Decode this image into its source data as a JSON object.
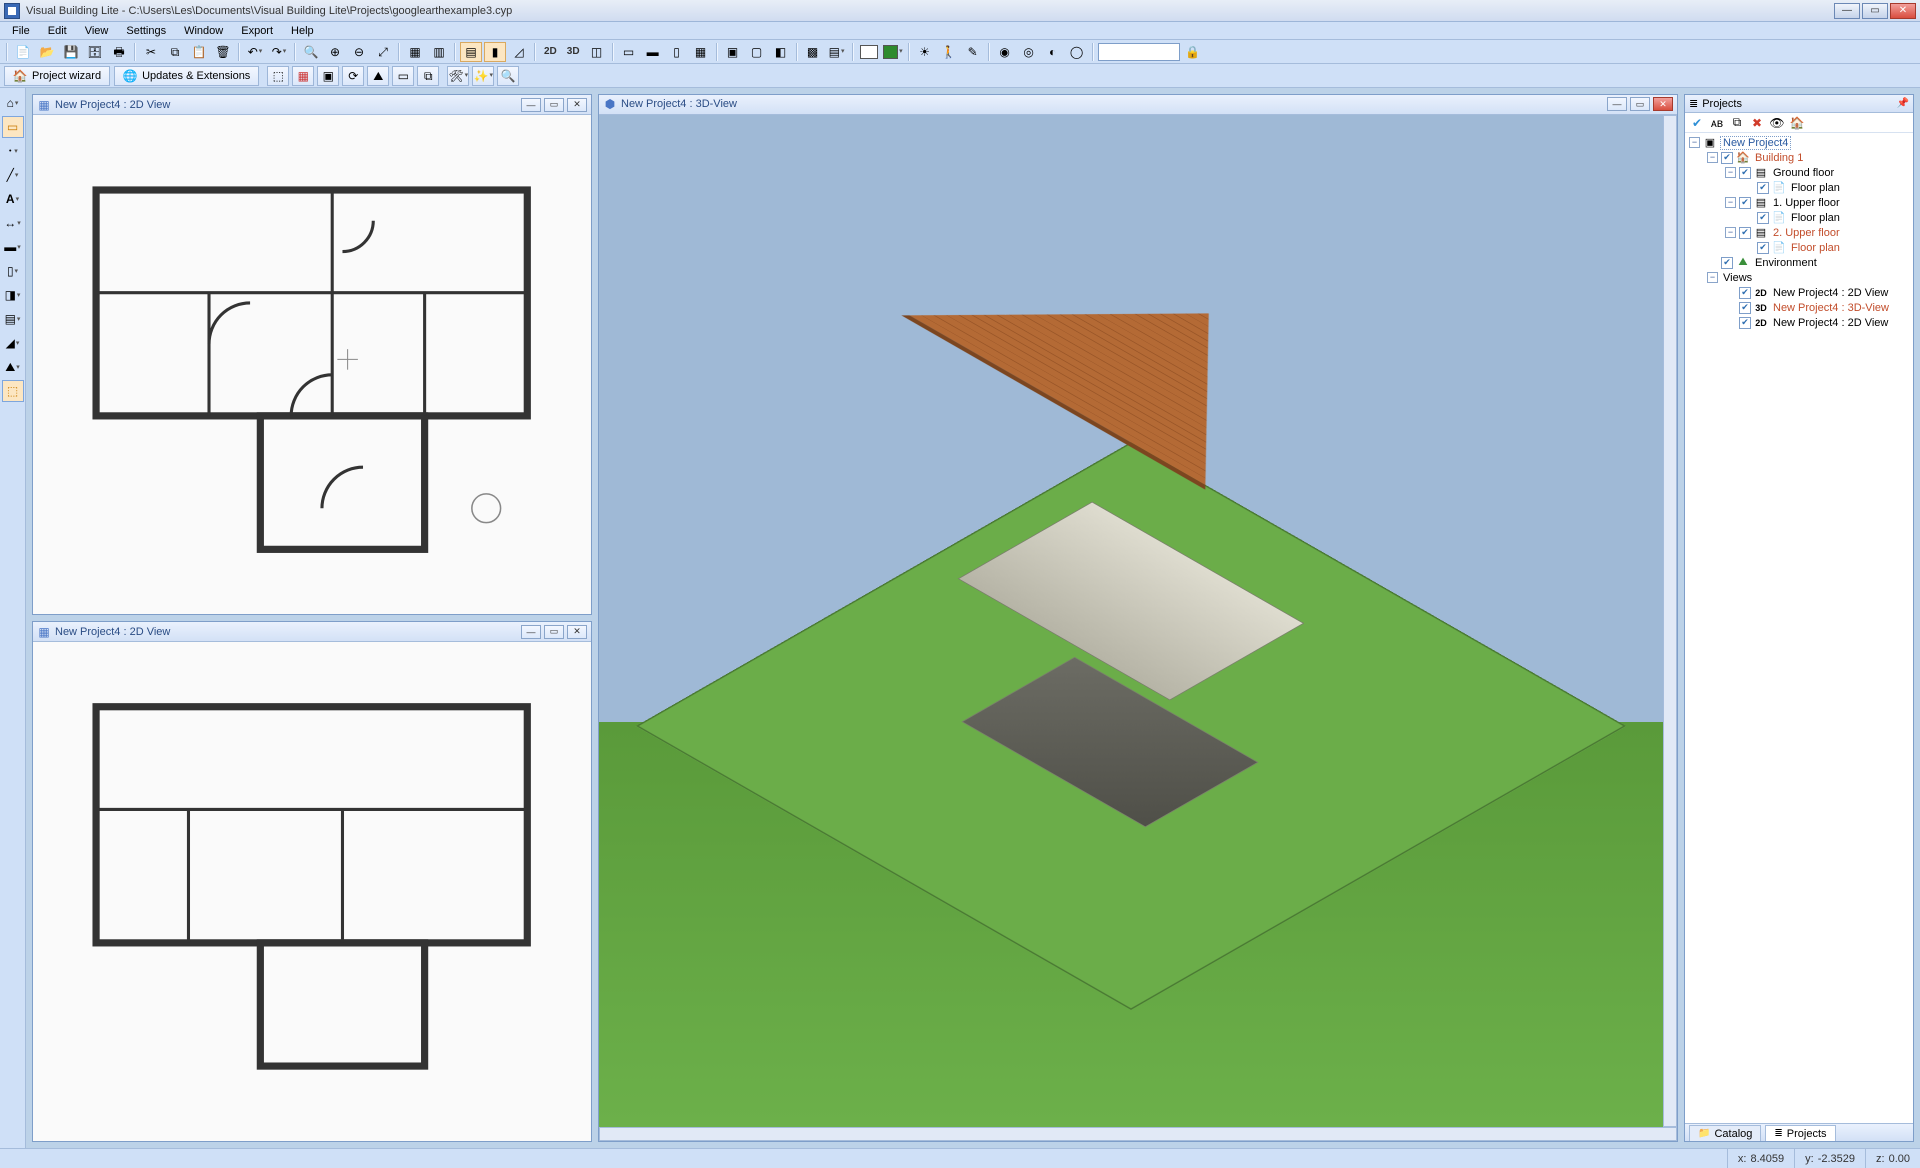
{
  "app": {
    "title": "Visual Building Lite - C:\\Users\\Les\\Documents\\Visual Building Lite\\Projects\\googlearthexample3.cyp"
  },
  "menu": {
    "file": "File",
    "edit": "Edit",
    "view": "View",
    "settings": "Settings",
    "window": "Window",
    "export": "Export",
    "help": "Help"
  },
  "wizard": {
    "project_wizard": "Project wizard",
    "updates_extensions": "Updates & Extensions"
  },
  "toolbar_labels": {
    "view2d": "2D",
    "view3d": "3D"
  },
  "inner_windows": {
    "plan_a": "New Project4 : 2D View",
    "plan_b": "New Project4 : 2D View",
    "view3d": "New Project4 : 3D-View"
  },
  "projects_panel": {
    "title": "Projects",
    "root": "New Project4",
    "building": "Building 1",
    "ground": "Ground floor",
    "floor_plan": "Floor plan",
    "upper1": "1. Upper floor",
    "upper2": "2. Upper floor",
    "environment": "Environment",
    "views": "Views",
    "view2d_a": "New Project4 : 2D View",
    "view3d": "New Project4 : 3D-View",
    "view2d_b": "New Project4 : 2D View",
    "tag2d": "2D",
    "tag3d": "3D"
  },
  "tabs_bottom": {
    "catalog": "Catalog",
    "projects": "Projects"
  },
  "status": {
    "x_label": "x:",
    "x_val": "8.4059",
    "y_label": "y:",
    "y_val": "-2.3529",
    "z_label": "z:",
    "z_val": "0.00"
  }
}
